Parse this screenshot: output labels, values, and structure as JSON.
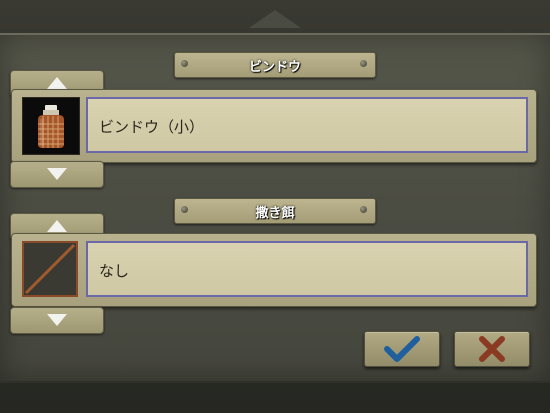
{
  "sections": [
    {
      "header": "ビンドウ",
      "item_name": "ビンドウ（小）",
      "icon": "bottle-trap-icon"
    },
    {
      "header": "撒き餌",
      "item_name": "なし",
      "icon": "empty-slot-icon"
    }
  ],
  "buttons": {
    "confirm_icon": "checkmark-icon",
    "cancel_icon": "x-icon"
  },
  "colors": {
    "confirm": "#1f5f9e",
    "cancel": "#8a3a22"
  }
}
